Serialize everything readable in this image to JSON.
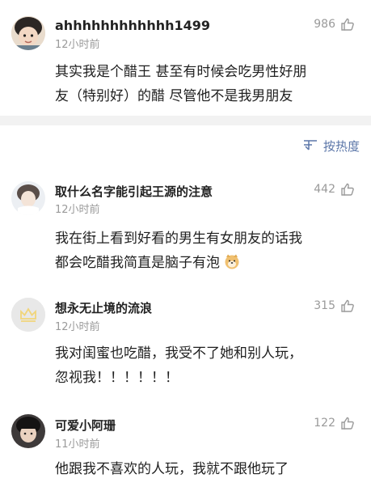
{
  "comments_top": {
    "username": "ahhhhhhhhhhhh1499",
    "time": "12小时前",
    "likes": "986",
    "text_line1": "其实我是个醋王 甚至有时候会吃男性好朋",
    "text_line2": "友（特别好）的醋 尽管他不是我男朋友"
  },
  "sort": {
    "label": "按热度"
  },
  "comments": [
    {
      "username": "取什么名字能引起王源的注意",
      "time": "12小时前",
      "likes": "442",
      "text_line1": "我在街上看到好看的男生有女朋友的话我",
      "text_line2": "都会吃醋我简直是脑子有泡",
      "emoji": "doge-emoji"
    },
    {
      "username": "想永无止境的流浪",
      "time": "12小时前",
      "likes": "315",
      "text_line1": "我对闺蜜也吃醋，我受不了她和别人玩，",
      "text_line2": "忽视我！！！！！！"
    },
    {
      "username": "可爱小阿珊",
      "time": "11小时前",
      "likes": "122",
      "text_line1": "他跟我不喜欢的人玩，我就不跟他玩了"
    }
  ],
  "icons": {
    "thumb": "thumbs-up-icon",
    "sort": "sort-lines-icon"
  },
  "colors": {
    "link": "#5b76a8",
    "muted": "#9a9a9a",
    "divider": "#f2f2f2"
  }
}
